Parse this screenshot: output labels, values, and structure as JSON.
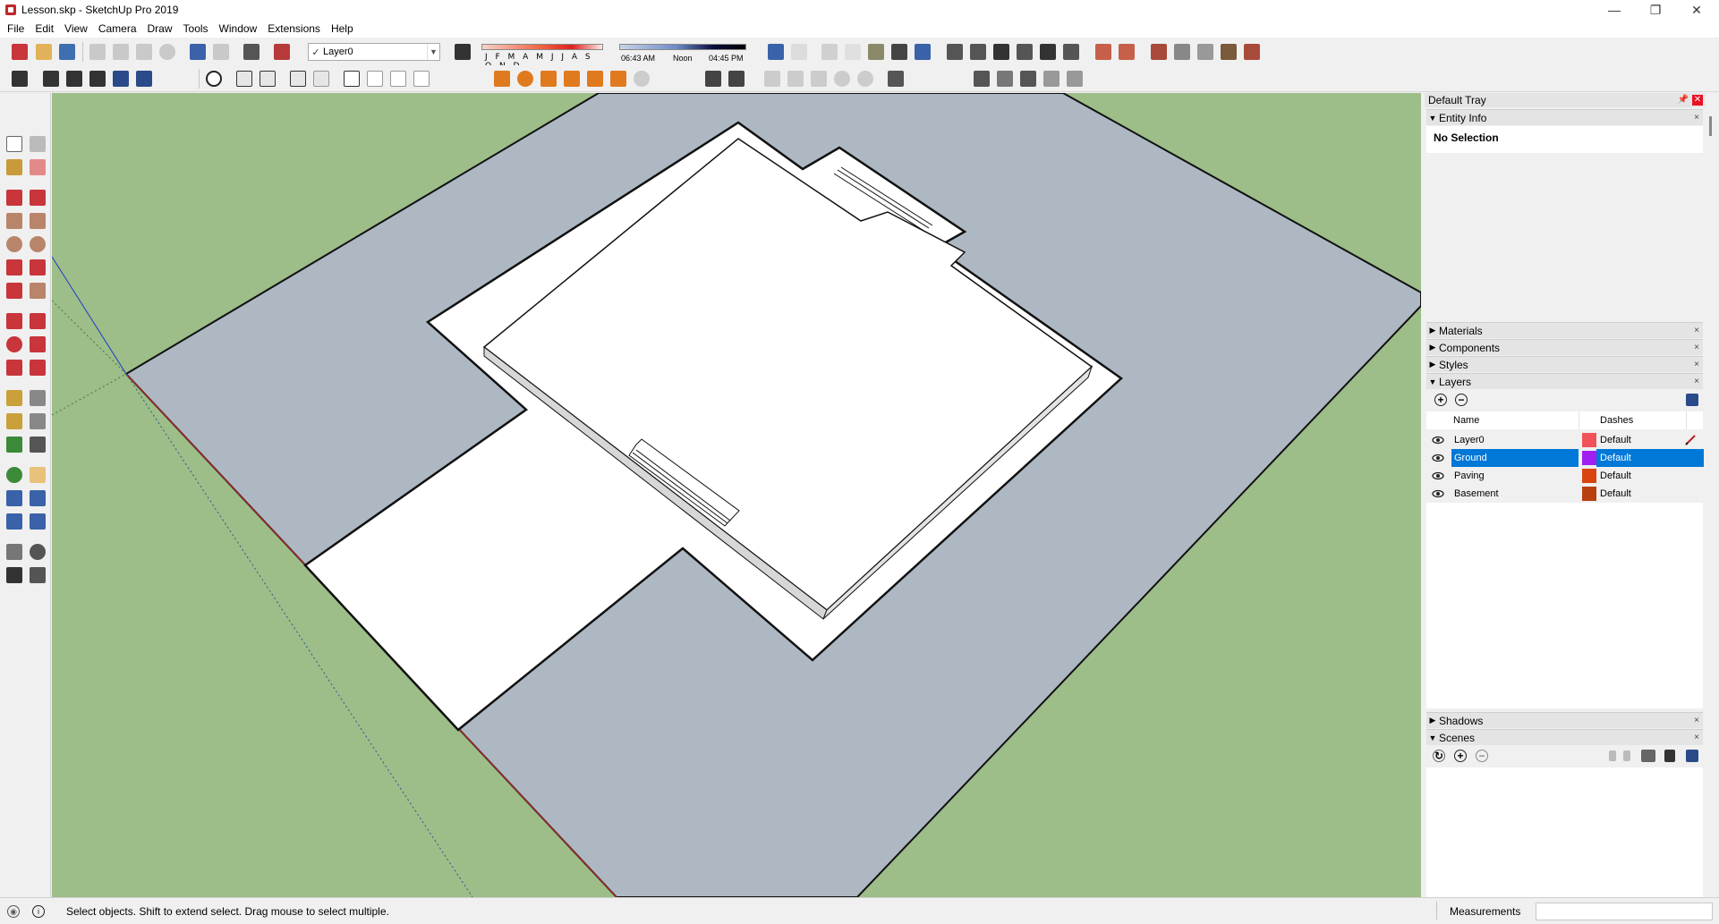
{
  "window": {
    "title": "Lesson.skp - SketchUp Pro 2019",
    "minimize": "—",
    "maximize": "❐",
    "close": "✕"
  },
  "menu": [
    "File",
    "Edit",
    "View",
    "Camera",
    "Draw",
    "Tools",
    "Window",
    "Extensions",
    "Help"
  ],
  "toolbar": {
    "layer_check": "✓",
    "current_layer": "Layer0",
    "shadow_months": "J F M A M J J A S O N D",
    "time_start": "06:43 AM",
    "time_noon": "Noon",
    "time_end": "04:45 PM"
  },
  "tray": {
    "title": "Default Tray",
    "pin": "📌",
    "close": "✕",
    "entity_info": {
      "label": "Entity Info",
      "content": "No Selection"
    },
    "materials": "Materials",
    "components": "Components",
    "styles": "Styles",
    "layers": {
      "label": "Layers",
      "col_name": "Name",
      "col_dashes": "Dashes",
      "rows": [
        {
          "name": "Layer0",
          "color": "#f0525a",
          "dashes": "Default",
          "selected": false
        },
        {
          "name": "Ground",
          "color": "#a020f0",
          "dashes": "Default",
          "selected": true
        },
        {
          "name": "Paving",
          "color": "#d9440e",
          "dashes": "Default",
          "selected": false
        },
        {
          "name": "Basement",
          "color": "#b8400f",
          "dashes": "Default",
          "selected": false
        }
      ]
    },
    "shadows": "Shadows",
    "scenes": "Scenes",
    "panel_close": "×",
    "arrow_collapsed": "▶",
    "arrow_expanded": "▼"
  },
  "status": {
    "message": "Select objects. Shift to extend select. Drag mouse to select multiple.",
    "measurements_label": "Measurements",
    "measurements_value": ""
  },
  "colors": {
    "sky_ground": "#9dbd89",
    "slab": "#adb8c3",
    "model": "#ffffff",
    "selection_blue": "#0078d7"
  }
}
